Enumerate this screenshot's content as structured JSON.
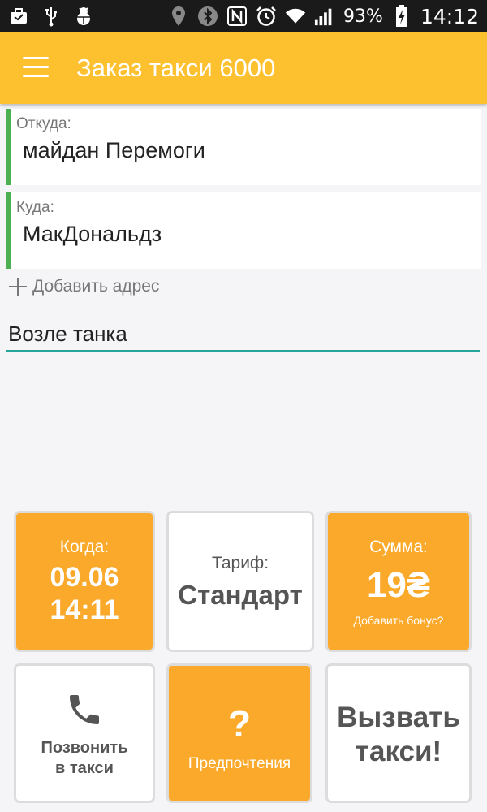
{
  "status_bar": {
    "left_icons": [
      "briefcase-icon",
      "usb-icon",
      "android-debug-icon"
    ],
    "right_icons": [
      "location-icon",
      "bluetooth-icon",
      "nfc-icon",
      "alarm-icon",
      "wifi-icon",
      "signal-icon"
    ],
    "battery": "93%",
    "time": "14:12"
  },
  "app_bar": {
    "title": "Заказ такси 6000",
    "menu_icon": "menu-icon"
  },
  "from": {
    "label": "Откуда:",
    "value": "майдан Перемоги"
  },
  "to": {
    "label": "Куда:",
    "value": "МакДональдз"
  },
  "add_address": "Добавить адрес",
  "comment": {
    "value": "Возле танка"
  },
  "tiles": {
    "when": {
      "label": "Когда:",
      "date": "09.06",
      "time": "14:11"
    },
    "tariff": {
      "label": "Тариф:",
      "value": "Стандарт"
    },
    "sum": {
      "label": "Сумма:",
      "value": "19₴",
      "bonus": "Добавить бонус?"
    },
    "call": {
      "line1": "Позвонить",
      "line2": "в такси",
      "icon": "phone-icon"
    },
    "prefs": {
      "symbol": "?",
      "label": "Предпочтения"
    },
    "order": {
      "line1": "Вызвать",
      "line2": "такси!"
    }
  },
  "colors": {
    "app_bar": "#fdc02f",
    "tile_orange": "#fba92a",
    "accent_green": "#4caf50",
    "input_underline": "#26a69a"
  }
}
